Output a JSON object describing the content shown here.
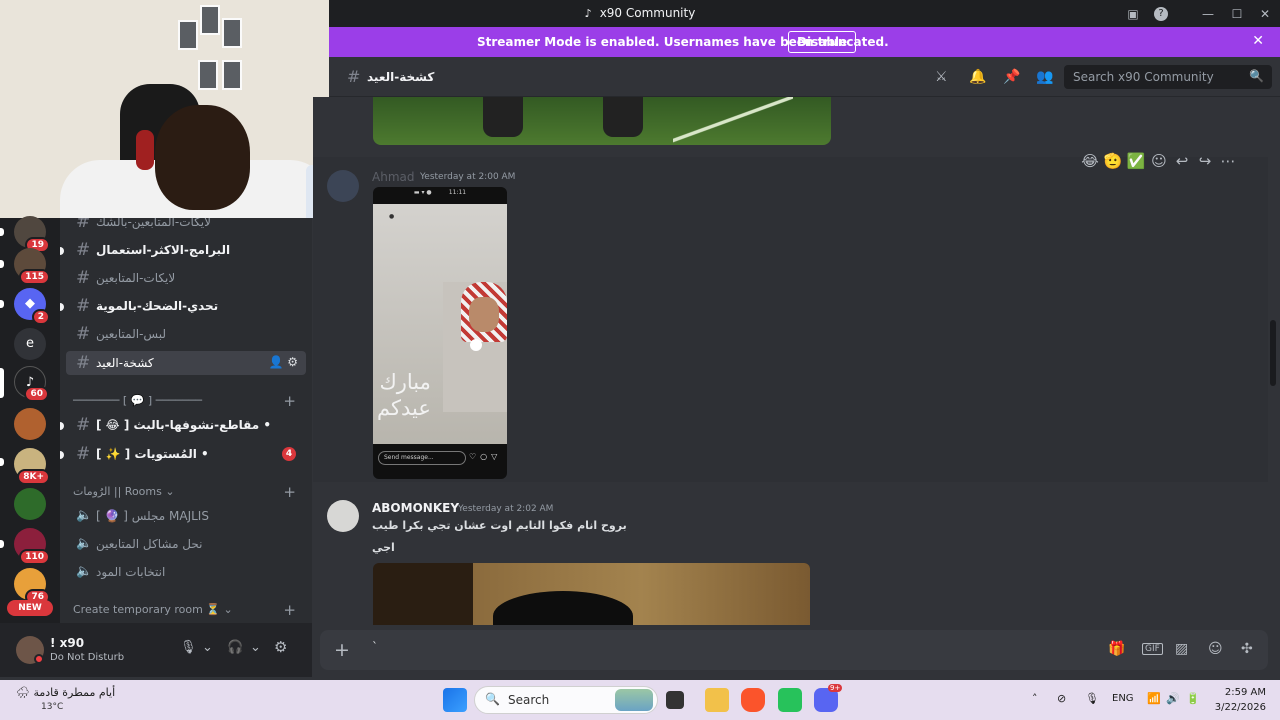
{
  "window": {
    "title": "x90 Community"
  },
  "streamer": {
    "message": "Streamer Mode is enabled. Usernames have been truncated.",
    "button": "Disable"
  },
  "servers": [
    {
      "badge": "19"
    },
    {
      "badge": "115"
    },
    {
      "badge": "2"
    },
    {
      "letter": "e"
    },
    {
      "badge": "60"
    },
    {
      "badge": ""
    },
    {
      "badge": "8K+"
    },
    {
      "badge": ""
    },
    {
      "badge": "110"
    },
    {
      "badge": "76"
    }
  ],
  "servers_new": "NEW",
  "channels": {
    "items": [
      {
        "name": "لايكات-المتابعين-بالشك",
        "state": "muted"
      },
      {
        "name": "البرامج-الاكثر-استعمال",
        "state": "unread"
      },
      {
        "name": "لايكات-المتابعين",
        "state": "muted"
      },
      {
        "name": "تحدي-الضحك-بالموية",
        "state": "unread"
      },
      {
        "name": "لبس-المتابعين",
        "state": "muted"
      },
      {
        "name": "كشخة-العيد",
        "state": "active"
      }
    ],
    "divider_label": "─────── [ 💬 ] ───────",
    "items2": [
      {
        "name": "[ 😂 ] مقاطع-نشوفها-بالبث •",
        "badge": ""
      },
      {
        "name": "[ ✨ ] المُستويات •",
        "badge": "4"
      }
    ],
    "rooms_category": "الرُومات || Rooms",
    "voice": [
      {
        "name": "[ 🔮 ] مجلس MAJLIS"
      },
      {
        "name": "نحل مشاكل المتابعين"
      },
      {
        "name": "انتخابات المود"
      }
    ],
    "temp_category": "Create temporary room ⏳"
  },
  "user": {
    "name": "! x90",
    "status": "Do Not Disturb"
  },
  "header": {
    "channel": "كشخة-العيد",
    "search_placeholder": "Search x90 Community"
  },
  "messages": [
    {
      "author": "Ahmad",
      "time": "Yesterday at 2:00 AM",
      "story_text": "مبارك\nعيدكم",
      "story_placeholder": "Send message..."
    },
    {
      "author": "ABOMONKEY",
      "time": "Yesterday at 2:02 AM",
      "lines": [
        "بروح انام فكوا التايم اوت عشان تجي بكرا طيب",
        "اجي"
      ]
    }
  ],
  "reactions": [
    "😂",
    "🫡",
    "✅"
  ],
  "composer": {
    "value": "`"
  },
  "taskbar": {
    "weather_text": "أيام ممطرة قادمة",
    "weather_temp": "13°C",
    "search_label": "Search",
    "lang": "ENG",
    "time": "2:59 AM",
    "date": "3/22/2026",
    "notif_badge": "9+"
  },
  "colors": {
    "streamer_bar": "#9b3ee8",
    "badge_red": "#da373c",
    "background": "#313338"
  }
}
